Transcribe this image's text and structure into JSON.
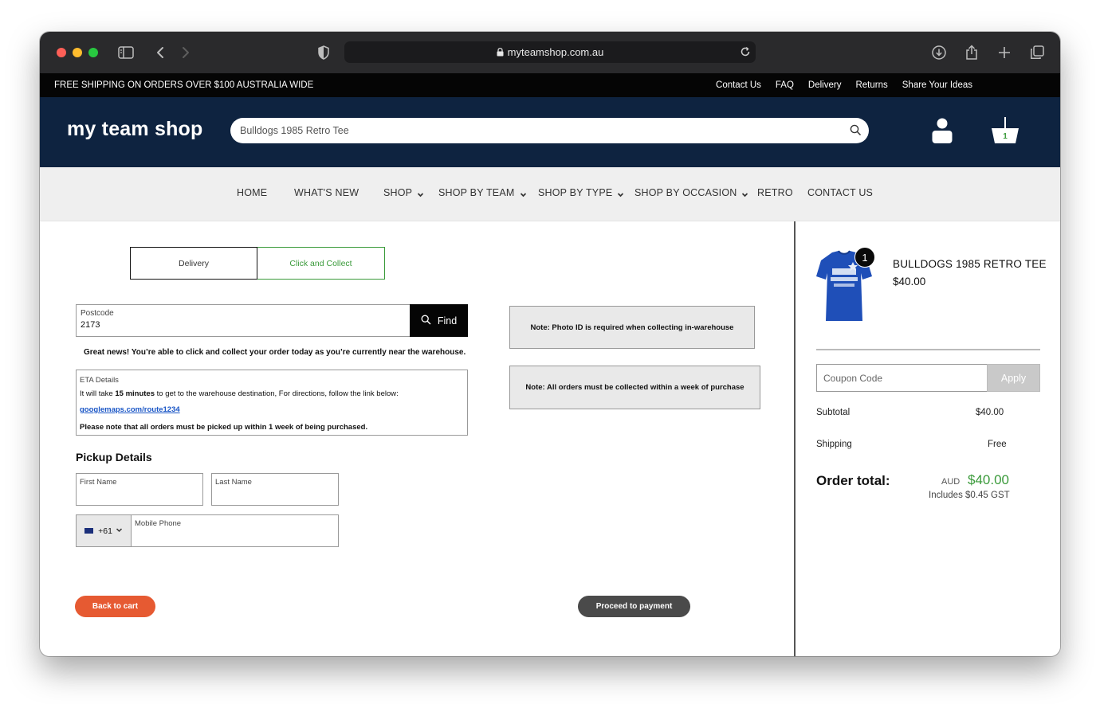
{
  "browser": {
    "url": "myteamshop.com.au"
  },
  "topbar": {
    "promo": "FREE SHIPPING ON ORDERS OVER $100 AUSTRALIA WIDE",
    "links": [
      "Contact Us",
      "FAQ",
      "Delivery",
      "Returns",
      "Share Your Ideas"
    ]
  },
  "header": {
    "logo": "my team shop",
    "search_value": "Bulldogs 1985 Retro Tee",
    "cart_count": "1"
  },
  "nav": {
    "items": [
      "HOME",
      "WHAT'S NEW",
      "SHOP",
      "SHOP BY TEAM",
      "SHOP BY TYPE",
      "SHOP BY OCCASION",
      "RETRO",
      "CONTACT US"
    ]
  },
  "tabs": {
    "delivery": "Delivery",
    "collect": "Click and Collect",
    "active": "Click and Collect"
  },
  "postcode": {
    "label": "Postcode",
    "value": "2173",
    "button": "Find"
  },
  "message": "Great news! You’re able to click and collect your order today as you’re currently near the warehouse.",
  "eta": {
    "label": "ETA Details",
    "line_prefix": "It will take ",
    "minutes": "15 minutes",
    "line_suffix": " to get to the warehouse destination, For directions, follow the link below:",
    "link": "googlemaps.com/route1234",
    "note": "Please note that all orders must be picked up within 1 week of being purchased."
  },
  "pickup": {
    "title": "Pickup Details",
    "first_name": "First Name",
    "last_name": "Last Name",
    "country_code": "+61",
    "mobile": "Mobile Phone"
  },
  "notes": {
    "photo_id": "Note: Photo ID is required when collecting in-warehouse",
    "collect_week": "Note: All orders must be collected within a week of purchase"
  },
  "actions": {
    "back": "Back to cart",
    "proceed": "Proceed to payment"
  },
  "summary": {
    "product_name": "BULLDOGS 1985 RETRO TEE",
    "product_price": "$40.00",
    "quantity": "1",
    "coupon_placeholder": "Coupon Code",
    "apply": "Apply",
    "subtotal_label": "Subtotal",
    "subtotal_value": "$40.00",
    "shipping_label": "Shipping",
    "shipping_value": "Free",
    "total_label": "Order total:",
    "currency": "AUD",
    "total_value": "$40.00",
    "gst": "Includes $0.45 GST"
  },
  "colors": {
    "header_bg": "#0e2340",
    "accent_green": "#3a9a3a",
    "back_button": "#e65a32",
    "link_blue": "#1a56c6"
  }
}
